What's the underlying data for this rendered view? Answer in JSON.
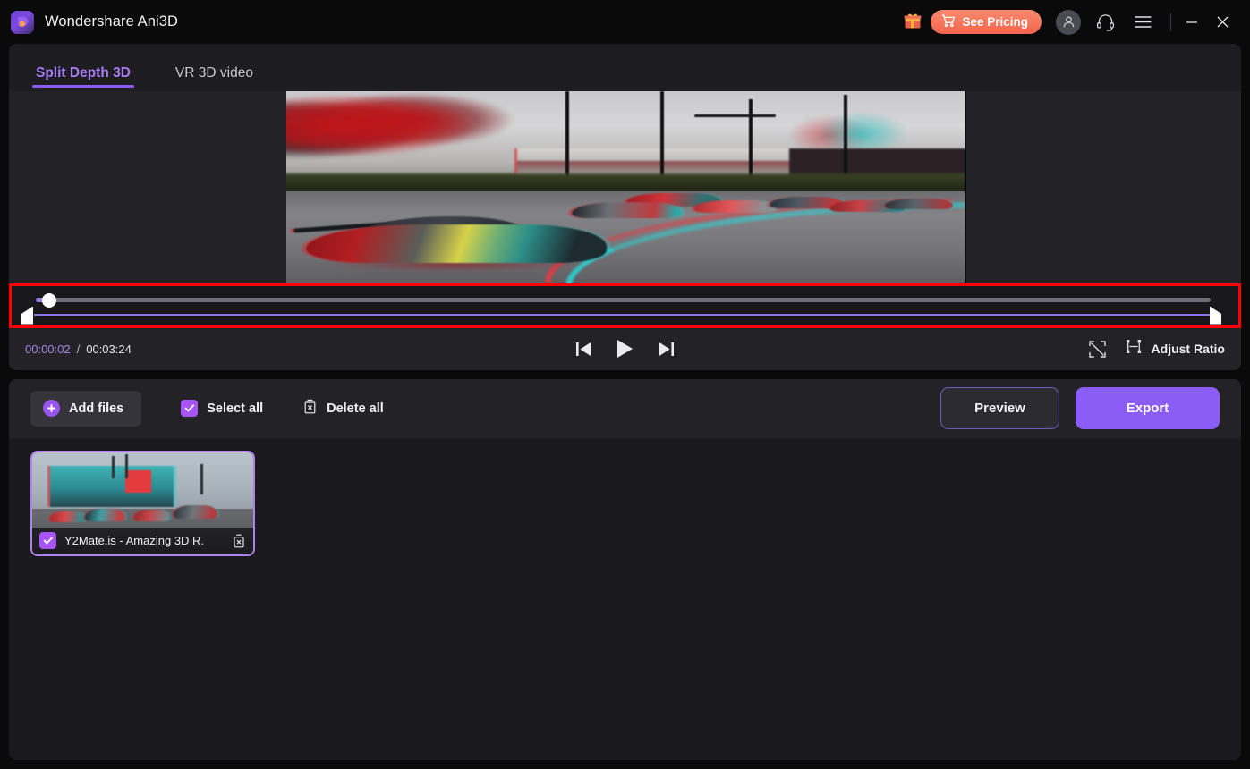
{
  "window": {
    "app_title": "Wondershare Ani3D",
    "logo_icon": "wondershare-logo-icon",
    "gift_icon": "gift-icon",
    "pricing_label": "See Pricing",
    "pricing_icon": "cart-icon",
    "avatar_icon": "user-avatar-icon",
    "support_icon": "headset-icon",
    "menu_icon": "hamburger-menu-icon",
    "minimize_icon": "minimize-icon",
    "close_icon": "close-icon",
    "accent_purple": "#8b5cf6",
    "accent_orange": "#f2654c"
  },
  "tabs": [
    {
      "label": "Split Depth 3D",
      "active": true
    },
    {
      "label": "VR 3D video",
      "active": false
    }
  ],
  "preview": {
    "content_description": "Anaglyph red-cyan 3D race car video",
    "annotation_color": "#fe0000"
  },
  "scrubber": {
    "playhead_percent": 1,
    "trim_start_percent": 0,
    "trim_end_percent": 100,
    "playhead_icon": "playhead-handle-icon",
    "trim_left_icon": "trim-start-handle-icon",
    "trim_right_icon": "trim-end-handle-icon"
  },
  "transport": {
    "current_time": "00:00:02",
    "separator": "/",
    "total_time": "00:03:24",
    "prev_icon": "skip-previous-icon",
    "play_icon": "play-icon",
    "next_icon": "skip-next-icon",
    "fullscreen_icon": "fullscreen-icon",
    "ratio_icon": "adjust-ratio-icon",
    "ratio_label": "Adjust Ratio"
  },
  "toolbar": {
    "add_files_label": "Add files",
    "add_files_icon": "plus-circle-icon",
    "select_all_label": "Select all",
    "select_all_icon": "checkbox-checked-icon",
    "delete_all_label": "Delete all",
    "delete_all_icon": "trash-icon",
    "preview_label": "Preview",
    "export_label": "Export"
  },
  "files": [
    {
      "name": "Y2Mate.is - Amazing 3D R.",
      "selected": true,
      "checkbox_icon": "checkbox-checked-icon",
      "delete_icon": "trash-icon"
    }
  ]
}
